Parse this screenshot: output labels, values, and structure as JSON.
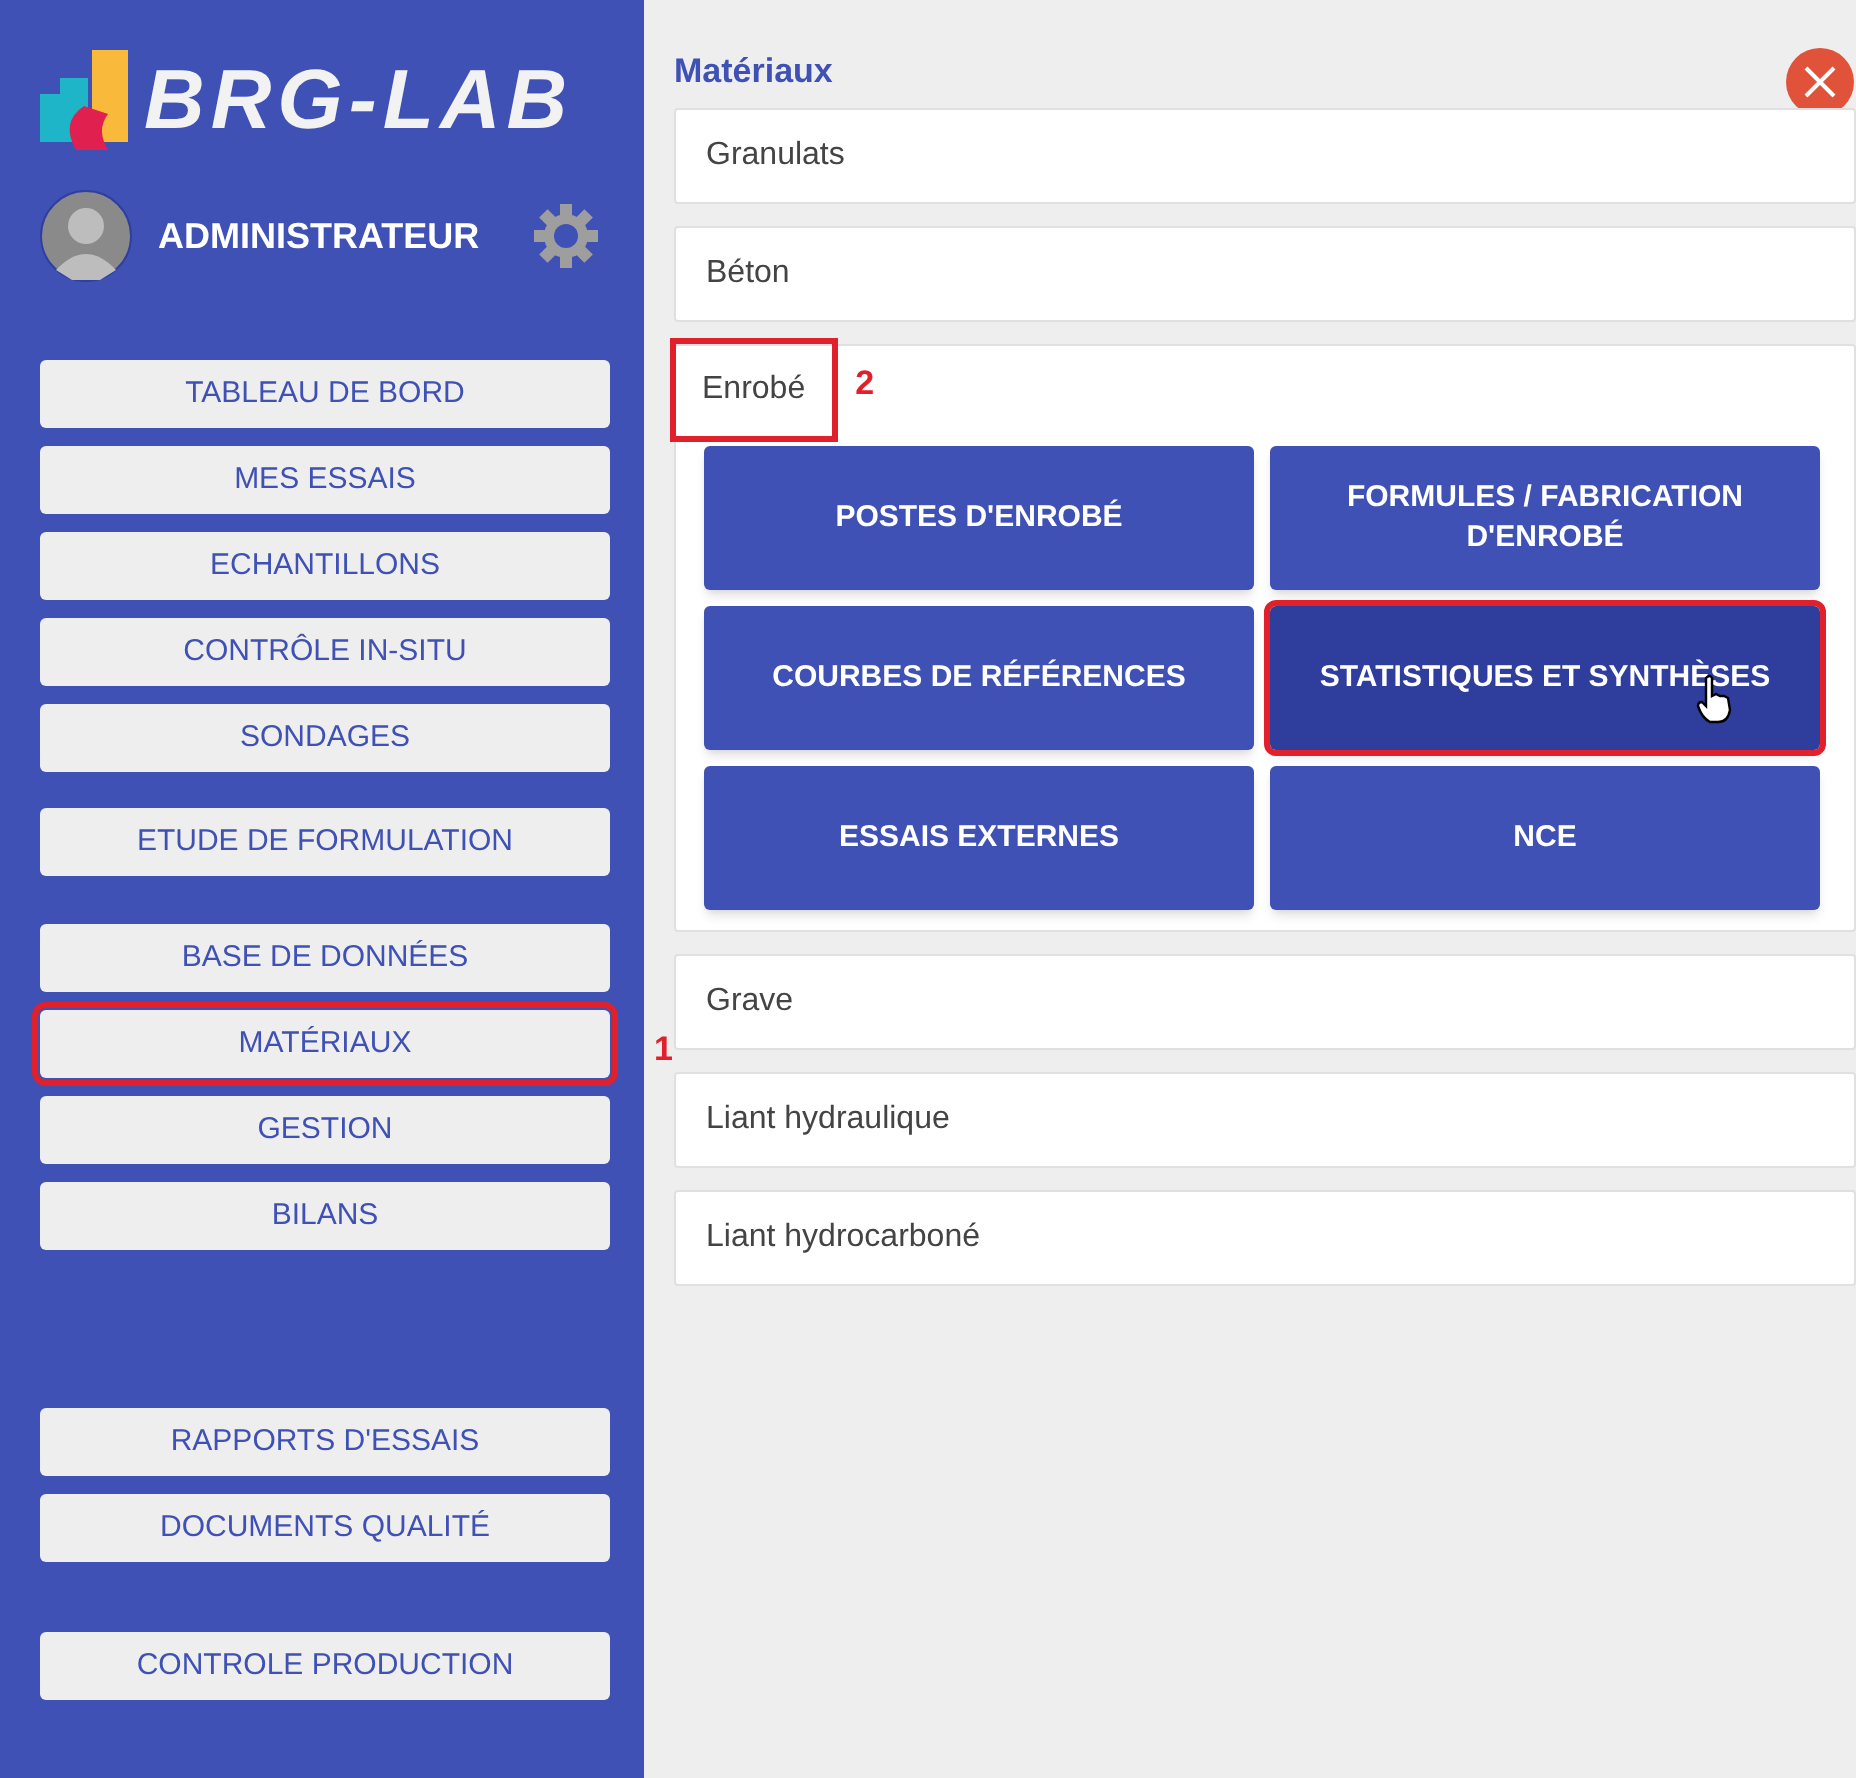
{
  "sidebar": {
    "brand": "BRG-LAB",
    "user": "ADMINISTRATEUR",
    "groups": [
      [
        {
          "label": "TABLEAU DE BORD",
          "highlighted": false
        },
        {
          "label": "MES ESSAIS",
          "highlighted": false
        },
        {
          "label": "ECHANTILLONS",
          "highlighted": false
        },
        {
          "label": "CONTRÔLE IN-SITU",
          "highlighted": false
        },
        {
          "label": "SONDAGES",
          "highlighted": false
        }
      ],
      [
        {
          "label": "ETUDE DE FORMULATION",
          "highlighted": false
        }
      ],
      [
        {
          "label": "BASE DE DONNÉES",
          "highlighted": false
        },
        {
          "label": "MATÉRIAUX",
          "highlighted": true,
          "marker": "1"
        },
        {
          "label": "GESTION",
          "highlighted": false
        },
        {
          "label": "BILANS",
          "highlighted": false
        }
      ],
      [
        {
          "label": "RAPPORTS D'ESSAIS",
          "highlighted": false
        },
        {
          "label": "DOCUMENTS QUALITÉ",
          "highlighted": false
        }
      ],
      [
        {
          "label": "CONTROLE PRODUCTION",
          "highlighted": false
        }
      ]
    ]
  },
  "main": {
    "title": "Matériaux",
    "sections": [
      {
        "label": "Granulats",
        "expanded": false,
        "highlighted": false
      },
      {
        "label": "Béton",
        "expanded": false,
        "highlighted": false
      },
      {
        "label": "Enrobé",
        "expanded": true,
        "highlighted": true,
        "marker": "2",
        "buttons": [
          {
            "label": "POSTES D'ENROBÉ",
            "highlighted": false,
            "hovered": false
          },
          {
            "label": "FORMULES / FABRICATION D'ENROBÉ",
            "highlighted": false,
            "hovered": false
          },
          {
            "label": "COURBES DE RÉFÉRENCES",
            "highlighted": false,
            "hovered": false
          },
          {
            "label": "STATISTIQUES ET SYNTHÈSES",
            "highlighted": true,
            "hovered": true
          },
          {
            "label": "ESSAIS EXTERNES",
            "highlighted": false,
            "hovered": false
          },
          {
            "label": "NCE",
            "highlighted": false,
            "hovered": false
          }
        ]
      },
      {
        "label": "Grave",
        "expanded": false,
        "highlighted": false
      },
      {
        "label": "Liant hydraulique",
        "expanded": false,
        "highlighted": false
      },
      {
        "label": "Liant hydrocarboné",
        "expanded": false,
        "highlighted": false
      }
    ]
  }
}
